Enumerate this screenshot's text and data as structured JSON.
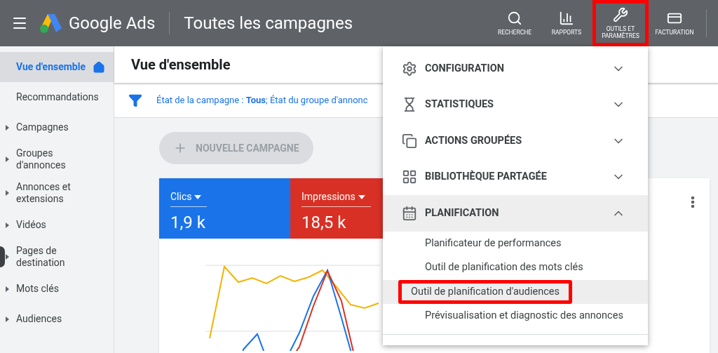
{
  "header": {
    "brand": "Google Ads",
    "title": "Toutes les campagnes",
    "tools": [
      {
        "label": "RECHERCHE",
        "highlighted": false
      },
      {
        "label": "RAPPORTS",
        "highlighted": false
      },
      {
        "label": "OUTILS ET PARAMÈTRES",
        "highlighted": true
      },
      {
        "label": "FACTURATION",
        "highlighted": false
      }
    ]
  },
  "sidebar": {
    "items": [
      {
        "label": "Vue d'ensemble",
        "selected": true,
        "expandable": false
      },
      {
        "label": "Recommandations",
        "selected": false,
        "expandable": false
      },
      {
        "label": "Campagnes",
        "selected": false,
        "expandable": true
      },
      {
        "label": "Groupes d'annonces",
        "selected": false,
        "expandable": true
      },
      {
        "label": "Annonces et extensions",
        "selected": false,
        "expandable": true
      },
      {
        "label": "Vidéos",
        "selected": false,
        "expandable": true
      },
      {
        "label": "Pages de destination",
        "selected": false,
        "expandable": true
      },
      {
        "label": "Mots clés",
        "selected": false,
        "expandable": true
      },
      {
        "label": "Audiences",
        "selected": false,
        "expandable": true
      }
    ]
  },
  "main": {
    "title": "Vue d'ensemble",
    "filter": "État de la campagne : **Tous**; État du groupe d'annonc",
    "new_button": {
      "label": "NOUVELLE CAMPAGNE",
      "disabled": true
    },
    "metrics": [
      {
        "label": "Clics",
        "value": "1,9 k",
        "color": "#1a73e8"
      },
      {
        "label": "Impressions",
        "value": "18,5 k",
        "color": "#d93025"
      }
    ]
  },
  "menu": {
    "sections": [
      {
        "label": "CONFIGURATION",
        "expanded": false
      },
      {
        "label": "STATISTIQUES",
        "expanded": false
      },
      {
        "label": "ACTIONS GROUPÉES",
        "expanded": false
      },
      {
        "label": "BIBLIOTHÈQUE PARTAGÉE",
        "expanded": false
      },
      {
        "label": "PLANIFICATION",
        "expanded": true,
        "children": [
          {
            "label": "Planificateur de performances",
            "selected": false,
            "highlighted": false
          },
          {
            "label": "Outil de planification des mots clés",
            "selected": false,
            "highlighted": false
          },
          {
            "label": "Outil de planification d'audiences",
            "selected": true,
            "highlighted": true
          },
          {
            "label": "Prévisualisation et diagnostic des annonces",
            "selected": false,
            "highlighted": false
          }
        ]
      }
    ]
  }
}
